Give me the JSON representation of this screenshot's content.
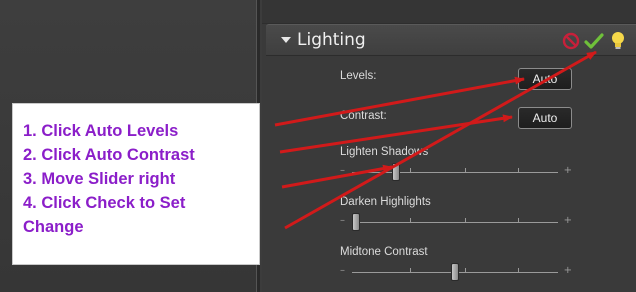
{
  "panel": {
    "section_title": "Lighting",
    "header_icons": [
      "cancel-icon",
      "checkmark-icon",
      "lightbulb-icon"
    ],
    "controls": {
      "levels_label": "Levels:",
      "levels_button": "Auto",
      "contrast_label": "Contrast:",
      "contrast_button": "Auto",
      "lighten_shadows_label": "Lighten Shadows",
      "darken_highlights_label": "Darken Highlights",
      "midtone_contrast_label": "Midtone Contrast"
    },
    "sliders": {
      "lighten_shadows": 0.2,
      "darken_highlights": 0.0,
      "midtone_contrast": 0.5
    }
  },
  "callout": {
    "steps": [
      "1. Click Auto Levels",
      "2. Click Auto Contrast",
      "3. Move Slider right",
      "4. Click Check to Set",
      "Change"
    ]
  },
  "colors": {
    "annotation_text": "#8b1ec9",
    "arrow": "#d11a1a",
    "panel_bg": "#3a3a3a",
    "check_green": "#6fc03a",
    "cancel_red": "#c8203a",
    "bulb_yellow": "#f5d84a"
  }
}
